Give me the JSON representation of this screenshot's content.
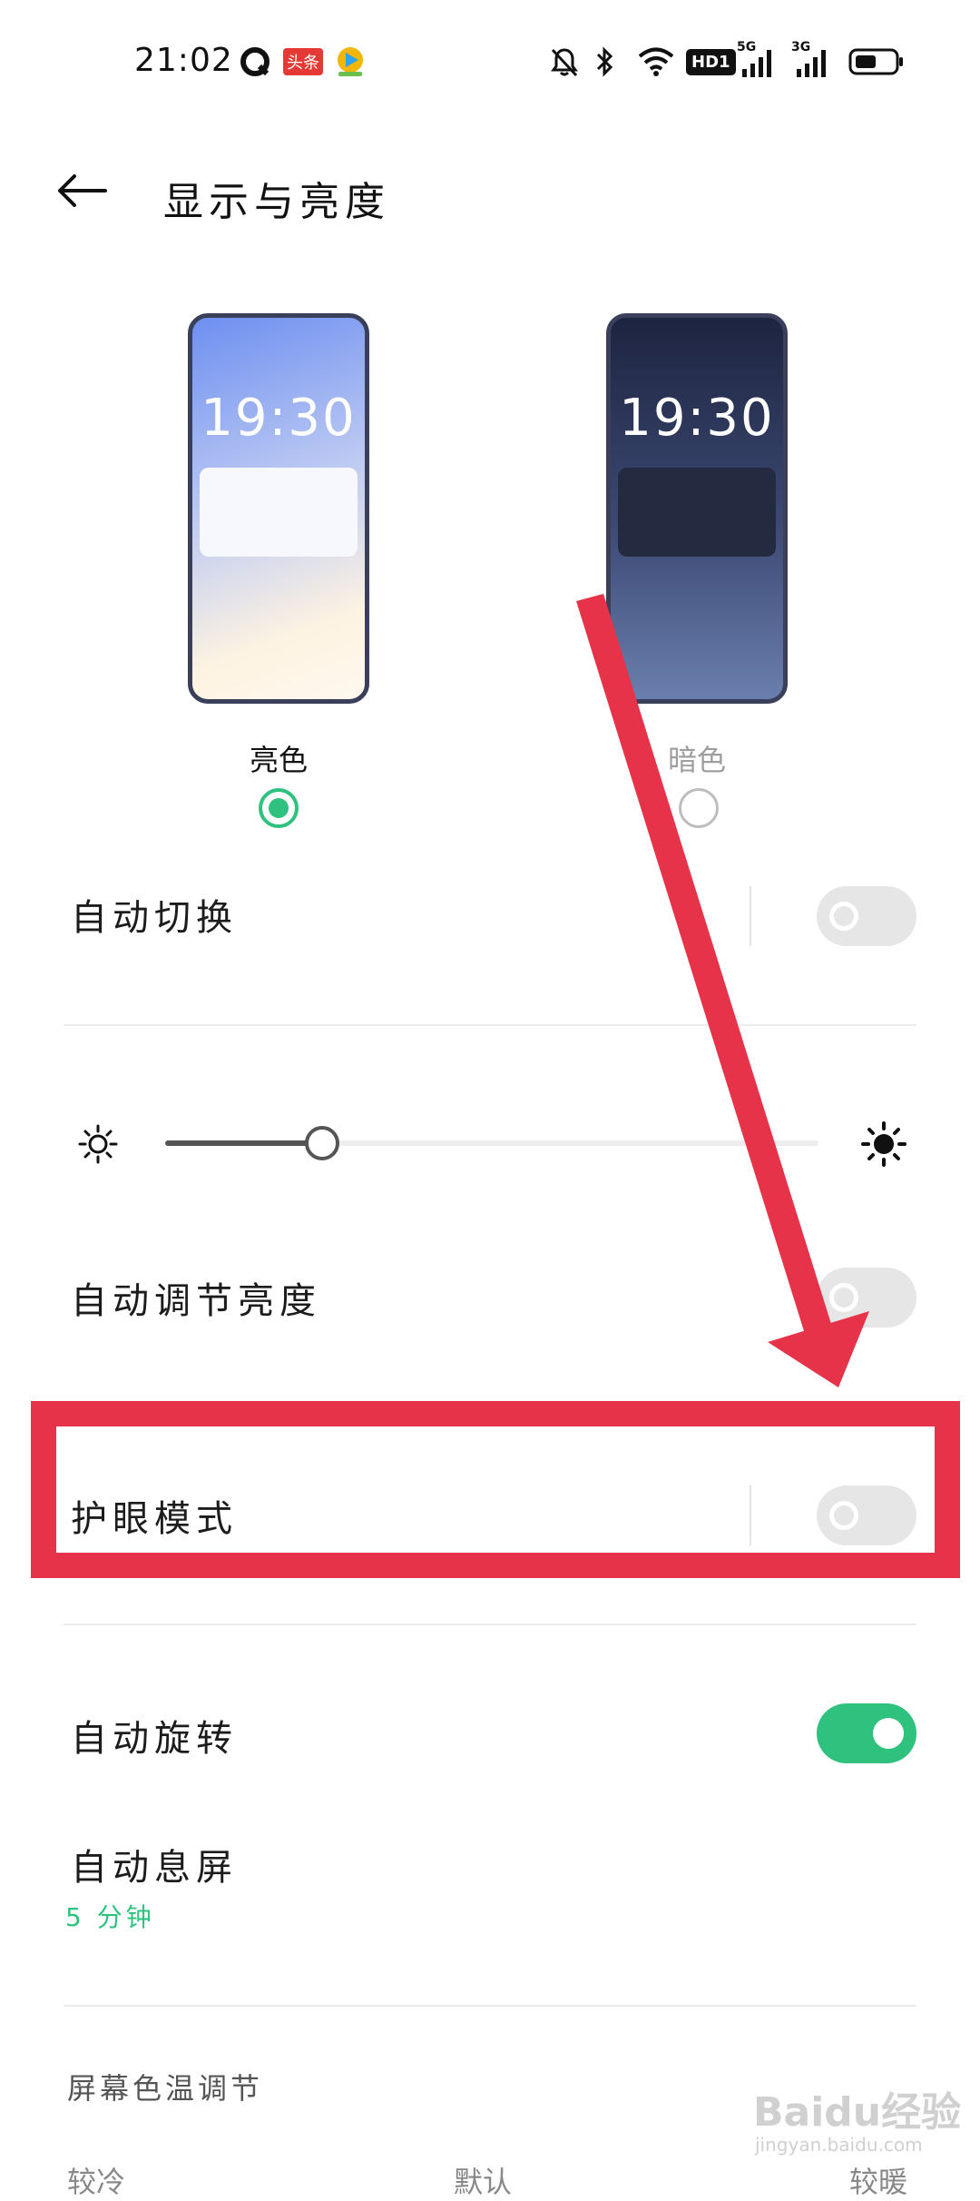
{
  "status_bar": {
    "time": "21:02",
    "app_badge": "头条",
    "hd_label": "HD1",
    "net1": "5G",
    "net2": "3G",
    "icons": [
      "q-app-icon",
      "toutiao-icon",
      "video-app-icon",
      "mute-bell-icon",
      "bluetooth-icon",
      "wifi-icon",
      "hd-icon",
      "signal-5g-icon",
      "signal-3g-icon",
      "battery-icon"
    ]
  },
  "header": {
    "title": "显示与亮度",
    "back_icon": "back-arrow-icon"
  },
  "themes": {
    "light": {
      "label": "亮色",
      "preview_time": "19:30",
      "selected": true
    },
    "dark": {
      "label": "暗色",
      "preview_time": "19:30",
      "selected": false
    }
  },
  "rows": {
    "auto_switch": {
      "label": "自动切换",
      "on": false
    },
    "auto_brightness": {
      "label": "自动调节亮度",
      "on": false
    },
    "eye_care": {
      "label": "护眼模式",
      "on": false
    },
    "auto_rotate": {
      "label": "自动旋转",
      "on": true
    },
    "auto_sleep": {
      "label": "自动息屏",
      "value": "5 分钟"
    }
  },
  "brightness": {
    "level": 0.24,
    "low_icon": "sun-low-icon",
    "high_icon": "sun-high-icon"
  },
  "color_temp": {
    "section_title": "屏幕色温调节",
    "options": [
      "较冷",
      "默认",
      "较暖"
    ]
  },
  "colors": {
    "accent": "#2ec27e",
    "annotation": "#e6334a"
  },
  "watermark": {
    "brand": "Baidu经验",
    "site": "jingyan.baidu.com"
  }
}
